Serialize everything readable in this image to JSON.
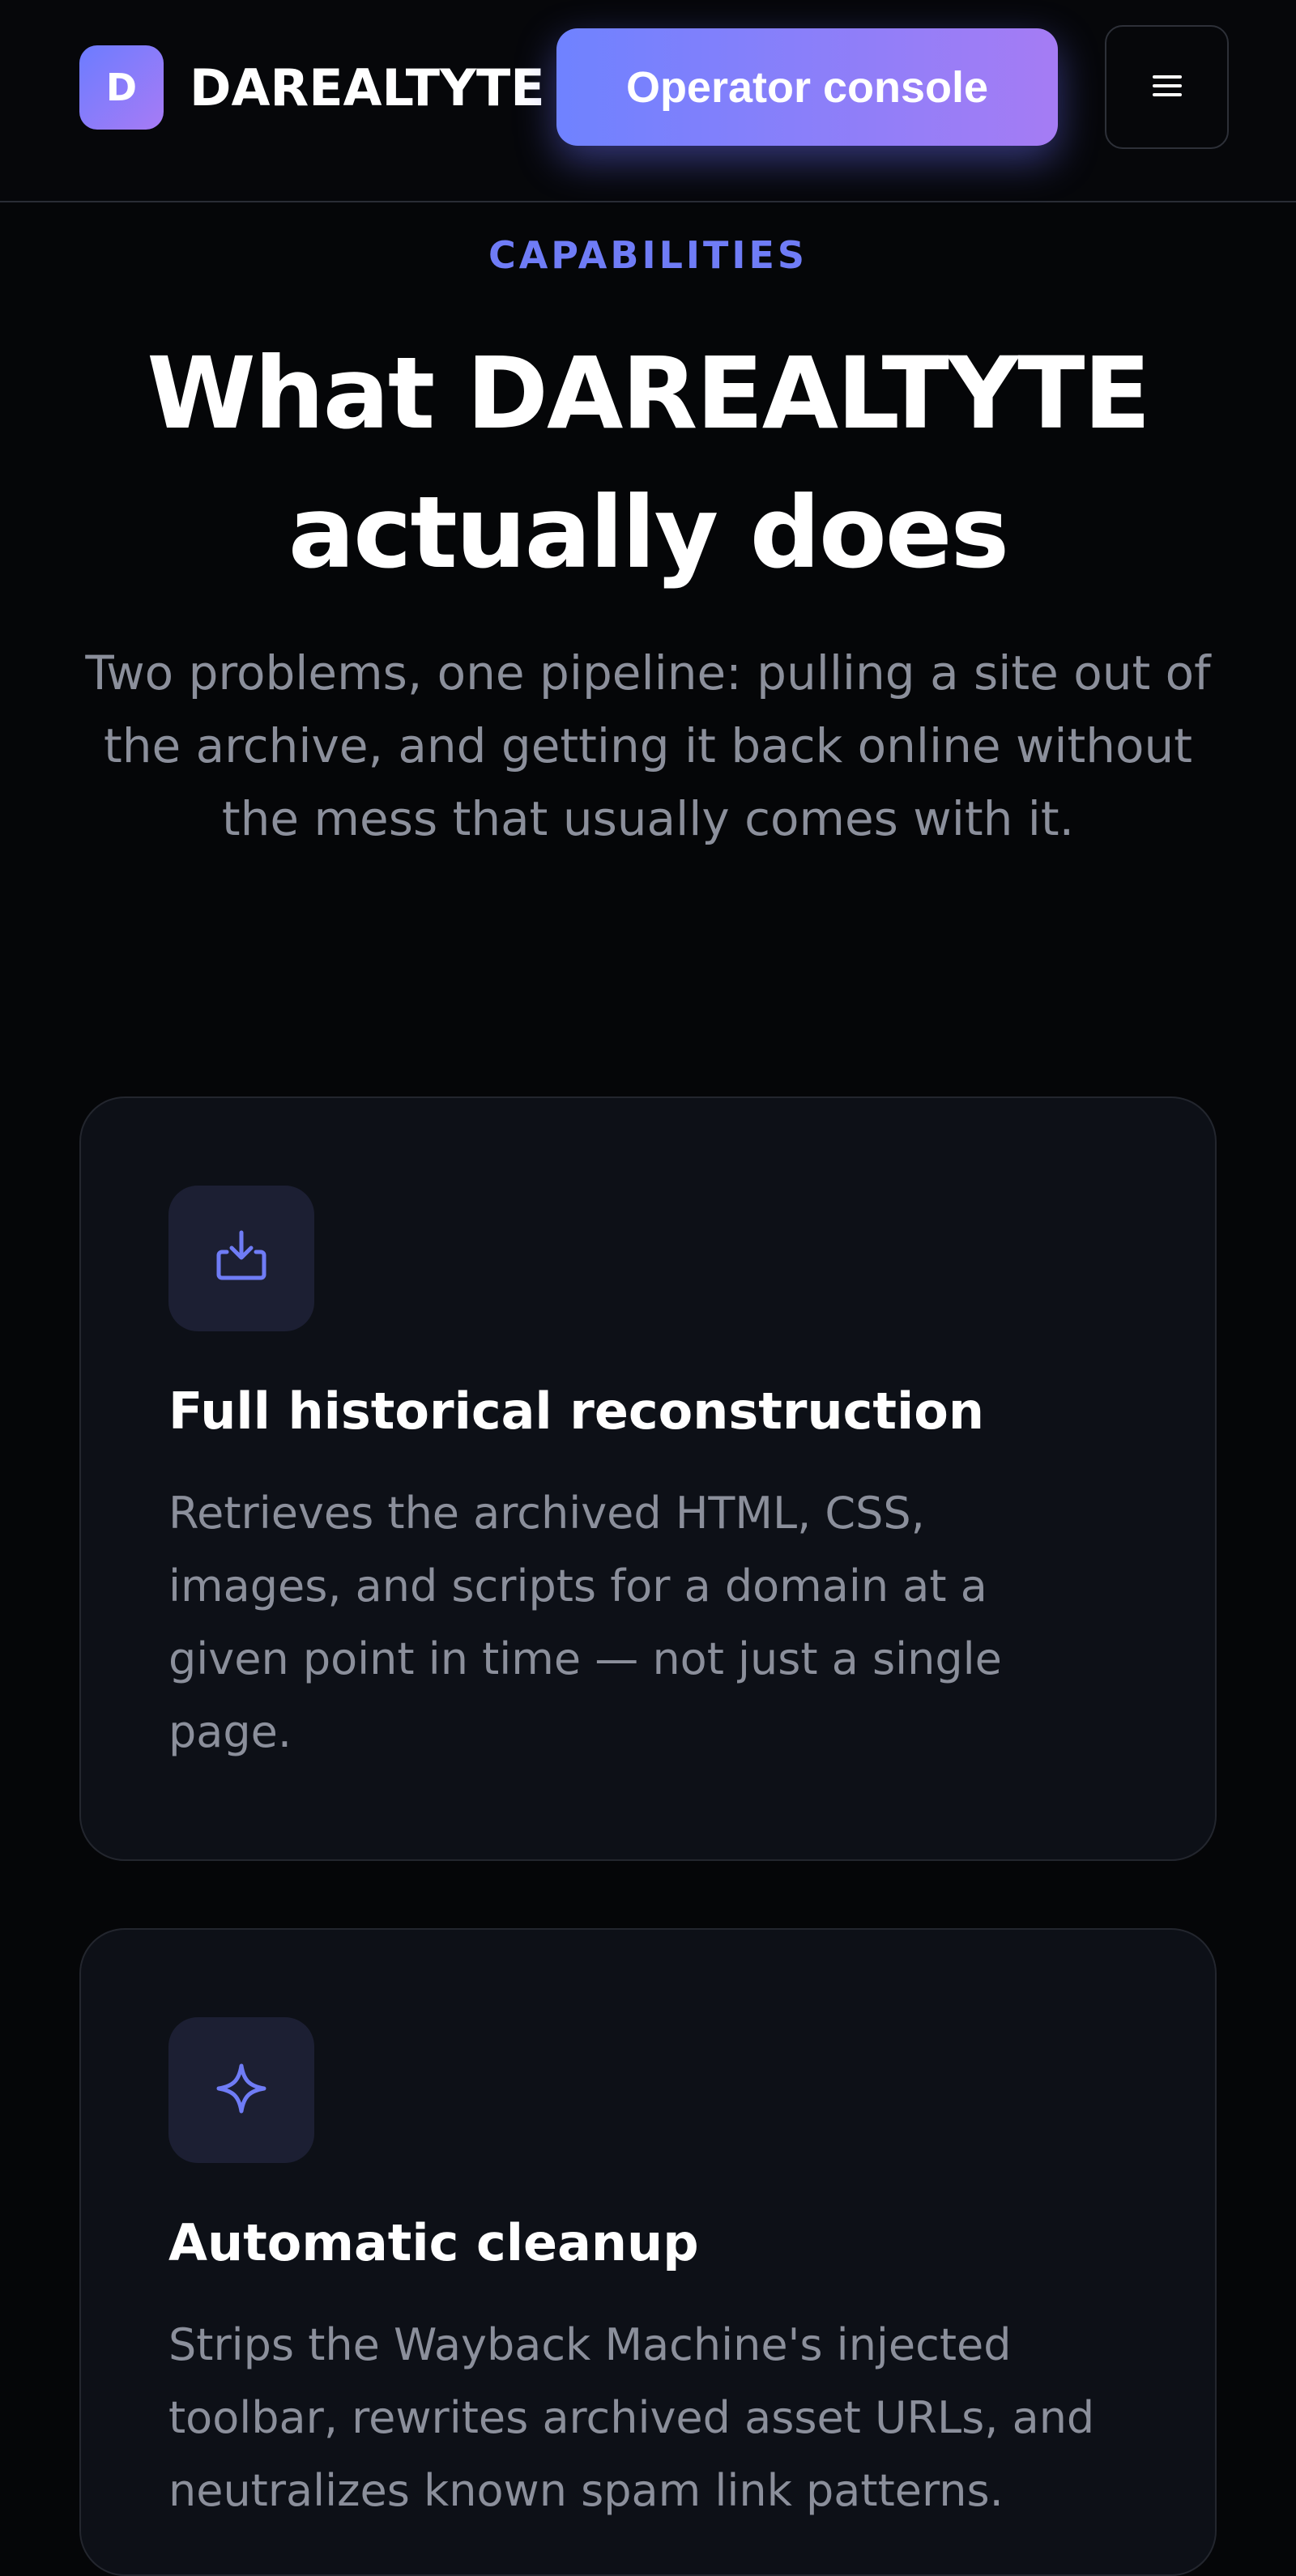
{
  "header": {
    "logo_letter": "D",
    "brand_name": "DAREALTYTE",
    "console_button_label": "Operator console",
    "menu_icon": "hamburger-menu-icon"
  },
  "hero": {
    "eyebrow": "CAPABILITIES",
    "title_line1": "What DAREALTYTE",
    "title_line2": "actually does",
    "lede": "Two problems, one pipeline: pulling a site out of the archive, and getting it back online without the mess that usually comes with it."
  },
  "capabilities": [
    {
      "icon": "download-tray-icon",
      "title": "Full historical reconstruction",
      "description": "Retrieves the archived HTML, CSS, images, and scripts for a domain at a given point in time — not just a single page."
    },
    {
      "icon": "sparkle-icon",
      "title": "Automatic cleanup",
      "description": "Strips the Wayback Machine's injected toolbar, rewrites archived asset URLs, and neutralizes known spam link patterns."
    }
  ],
  "colors": {
    "background": "#050608",
    "accent": "#6f7cf6",
    "gradient_start": "#6f82ff",
    "gradient_end": "#a57cf4",
    "card_background": "#0d1017",
    "muted_text": "#8b8f9b"
  }
}
